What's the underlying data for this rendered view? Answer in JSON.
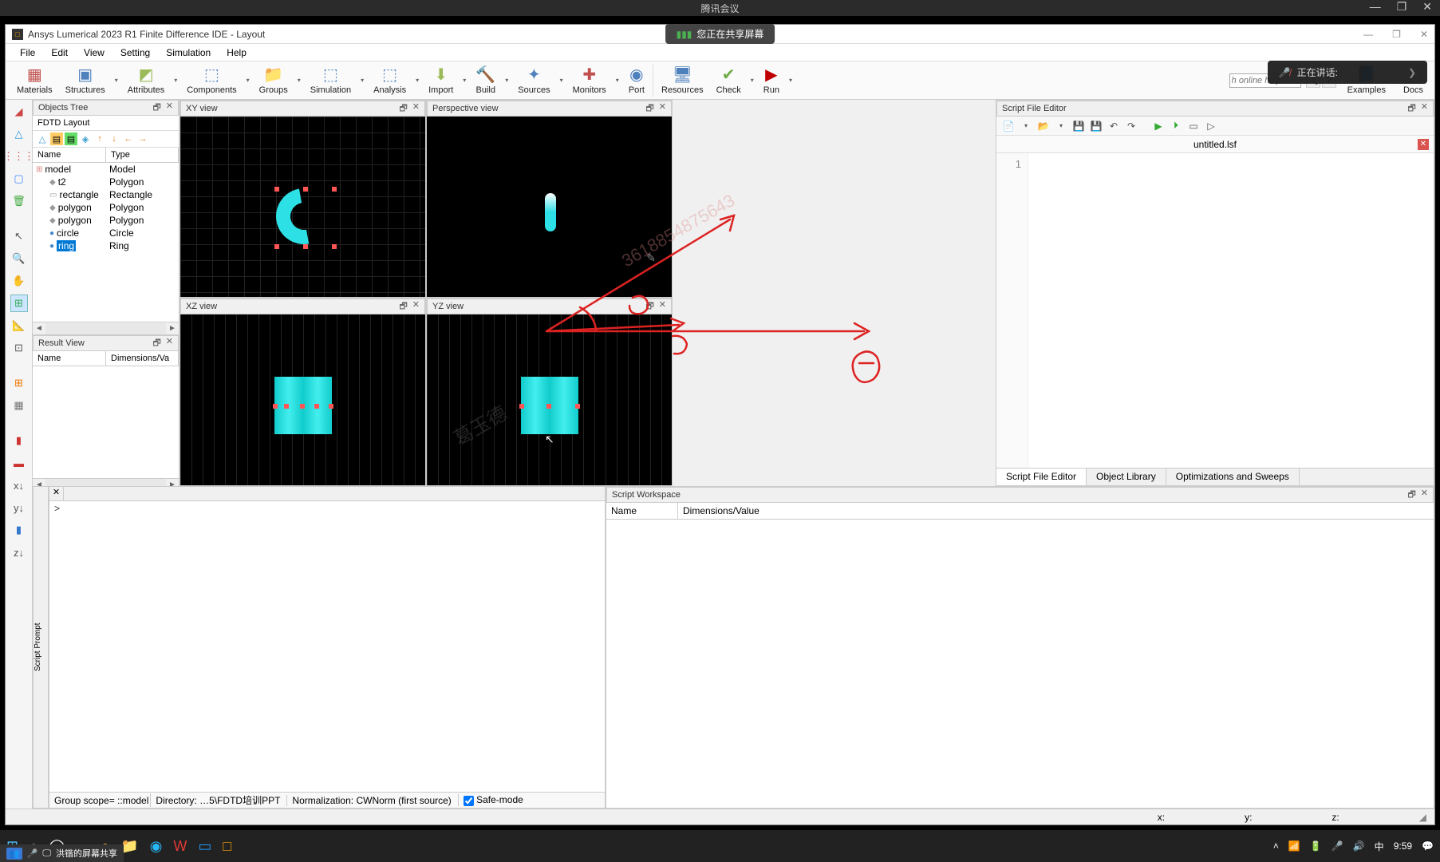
{
  "meeting": {
    "title": "腾讯会议",
    "share_status": "您正在共享屏幕",
    "speaking": "正在讲话:",
    "sharing_footer": "洪锴的屏幕共享"
  },
  "app": {
    "title": "Ansys Lumerical 2023 R1 Finite Difference IDE - Layout",
    "menu": [
      "File",
      "Edit",
      "View",
      "Setting",
      "Simulation",
      "Help"
    ],
    "toolbar": [
      "Materials",
      "Structures",
      "Attributes",
      "Components",
      "Groups",
      "Simulation",
      "Analysis",
      "Import",
      "Build",
      "Sources",
      "Monitors",
      "Port",
      "Resources",
      "Check",
      "Run",
      "Examples",
      "Docs"
    ],
    "search_placeholder": "h online help"
  },
  "objects": {
    "panel_title": "Objects Tree",
    "layout_label": "FDTD Layout",
    "col_name": "Name",
    "col_type": "Type",
    "items": [
      {
        "name": "model",
        "type": "Model",
        "indent": 0,
        "icon": "⊞",
        "sel": false,
        "color": "#d88"
      },
      {
        "name": "t2",
        "type": "Polygon",
        "indent": 1,
        "icon": "◆",
        "sel": false,
        "color": "#999"
      },
      {
        "name": "rectangle",
        "type": "Rectangle",
        "indent": 1,
        "icon": "▭",
        "sel": false,
        "color": "#999"
      },
      {
        "name": "polygon",
        "type": "Polygon",
        "indent": 1,
        "icon": "◆",
        "sel": false,
        "color": "#999"
      },
      {
        "name": "polygon",
        "type": "Polygon",
        "indent": 1,
        "icon": "◆",
        "sel": false,
        "color": "#999"
      },
      {
        "name": "circle",
        "type": "Circle",
        "indent": 1,
        "icon": "●",
        "sel": false,
        "color": "#48c"
      },
      {
        "name": "ring",
        "type": "Ring",
        "indent": 1,
        "icon": "●",
        "sel": true,
        "color": "#48c"
      }
    ]
  },
  "result": {
    "panel_title": "Result View",
    "col_name": "Name",
    "col_dim": "Dimensions/Va"
  },
  "views": {
    "xy": "XY view",
    "persp": "Perspective view",
    "xz": "XZ view",
    "yz": "YZ view"
  },
  "script": {
    "panel_title": "Script File Editor",
    "filename": "untitled.lsf",
    "line1": "1",
    "tabs": [
      "Script File Editor",
      "Object Library",
      "Optimizations and Sweeps"
    ]
  },
  "workspace": {
    "panel_title": "Script Workspace",
    "col_name": "Name",
    "col_dim": "Dimensions/Value"
  },
  "prompt": {
    "label": "Script Prompt",
    "prompt_char": ">",
    "status_scope": "Group scope= ::model",
    "status_dir": "Directory: …5\\FDTD培训PPT",
    "status_norm": "Normalization: CWNorm (first source)",
    "status_safe": "Safe-mode"
  },
  "statusbar": {
    "x": "x:",
    "y": "y:",
    "z": "z:"
  },
  "taskbar": {
    "time": "9:59",
    "ime": "中"
  }
}
